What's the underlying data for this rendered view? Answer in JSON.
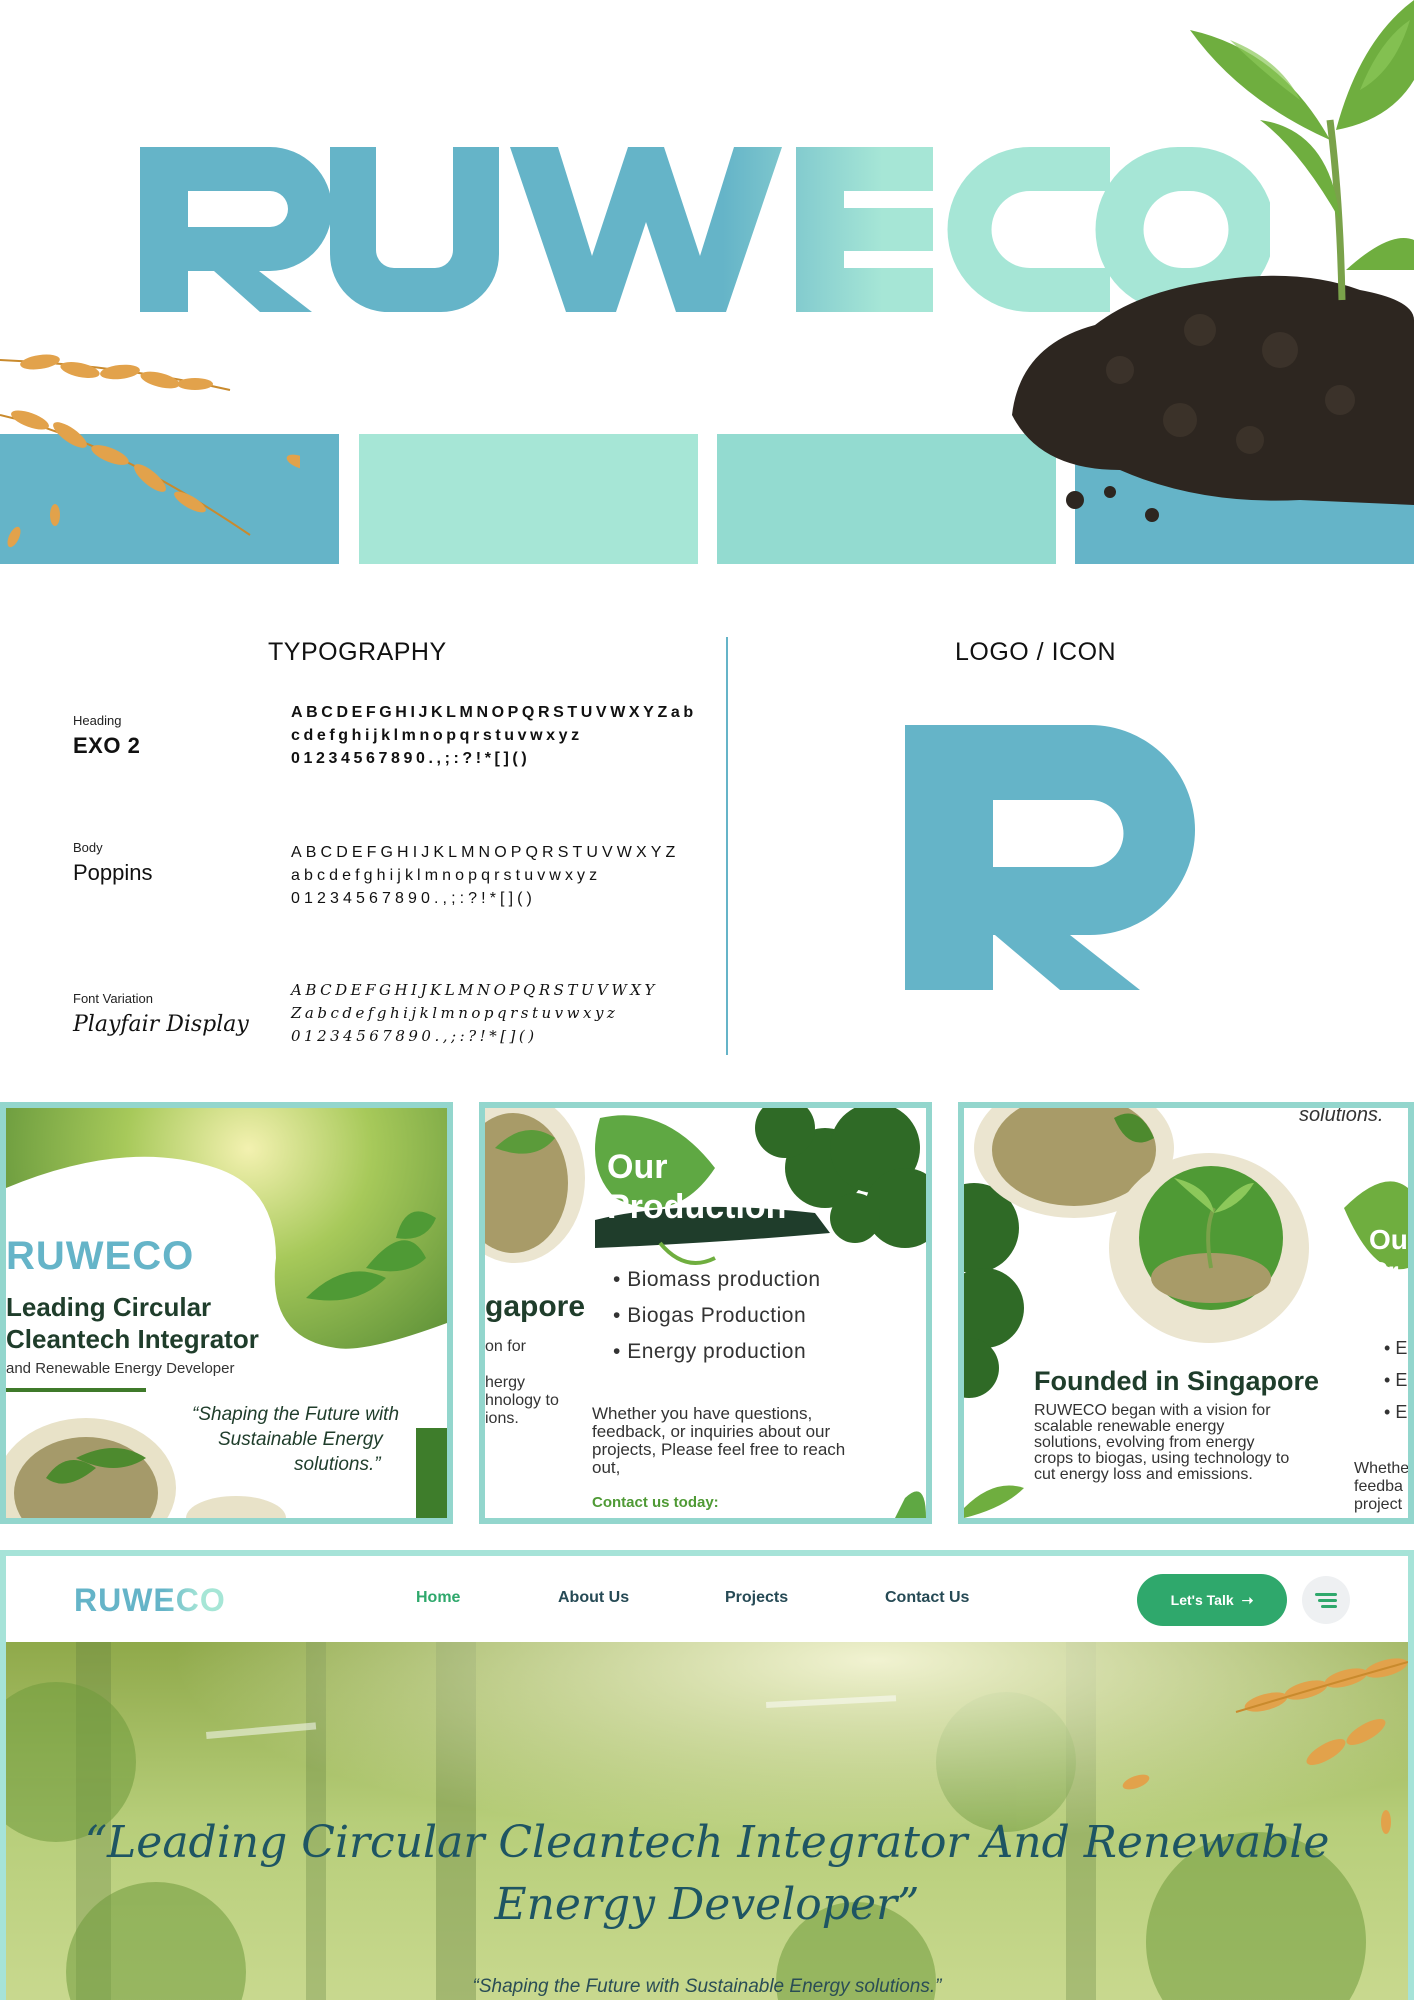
{
  "brand": {
    "wordmark": "RUWECO",
    "colors": {
      "teal": "#65b4c8",
      "mint": "#a6e6d6",
      "aqua": "#93dbd0",
      "green": "#2fa86c",
      "dark_green": "#1f3d2b"
    }
  },
  "hero": {
    "swatches": [
      "#65b4c8",
      "#a6e6d6",
      "#93dbd0",
      "#65b4c8"
    ],
    "images": [
      "wheat-image",
      "soil-plant-image"
    ]
  },
  "typography": {
    "title": "TYPOGRAPHY",
    "fonts": [
      {
        "role": "Heading",
        "name": "EXO 2",
        "glyphs": "ABCDEFGHIJKLMNOPQRSTUVWXYZab\ncdefghijklmnopqrstuvwxyz\n01234567890.,;:?!*[]()"
      },
      {
        "role": "Body",
        "name": "Poppins",
        "glyphs": "ABCDEFGHIJKLMNOPQRSTUVWXYZ\nabcdefghijklmnopqrstuvwxyz\n01234567890.,;:?!*[]()"
      },
      {
        "role": "Font Variation",
        "name": "Playfair Display",
        "glyphs": "ABCDEFGHIJKLMNOPQRSTUVWXY\nZabcdefghijklmnopqrstuvwxyz\n01234567890.,;:?!*[]()"
      }
    ]
  },
  "logo_section": {
    "title": "LOGO / ICON",
    "icon_letter": "R"
  },
  "posts": [
    {
      "brand": "RUWECO",
      "headline_1": "Leading Circular",
      "headline_2": "Cleantech Integrator",
      "subline": "and Renewable Energy Developer",
      "quote_1": "“Shaping the Future with",
      "quote_2": "Sustainable Energy",
      "quote_3": "solutions.”"
    },
    {
      "title_1": "Our",
      "title_2": "Production",
      "bullets": [
        "Biomass production",
        "Biogas Production",
        "Energy production"
      ],
      "partial_heading": "gapore",
      "partial_lines": [
        "on for",
        "",
        "hergy",
        "hnology to",
        "ions."
      ],
      "body_1": "Whether you have questions,",
      "body_2": "feedback, or inquiries about our",
      "body_3": "projects, Please feel free to reach",
      "body_4": "out,",
      "cta": "Contact us today:"
    },
    {
      "top_partial": "solutions.",
      "heading": "Founded in Singapore",
      "body_1": "RUWECO began with a vision for",
      "body_2": "scalable renewable energy",
      "body_3": "solutions, evolving from energy",
      "body_4": "crops to biogas, using technology to",
      "body_5": "cut energy loss and emissions.",
      "partial_title_1": "Ou",
      "partial_title_2": "Pr",
      "partial_bullets": [
        "E",
        "E",
        "E"
      ],
      "partial_body": [
        "Whethe",
        "feedba",
        "project"
      ]
    }
  ],
  "website": {
    "logo": "RUWECO",
    "nav": [
      "Home",
      "About Us",
      "Projects",
      "Contact Us"
    ],
    "active_nav": "Home",
    "cta": "Let's Talk",
    "headline_1": "“Leading Circular Cleantech Integrator And Renewable",
    "headline_2": "Energy Developer”",
    "subheadline": "“Shaping the Future with Sustainable Energy solutions.”"
  }
}
